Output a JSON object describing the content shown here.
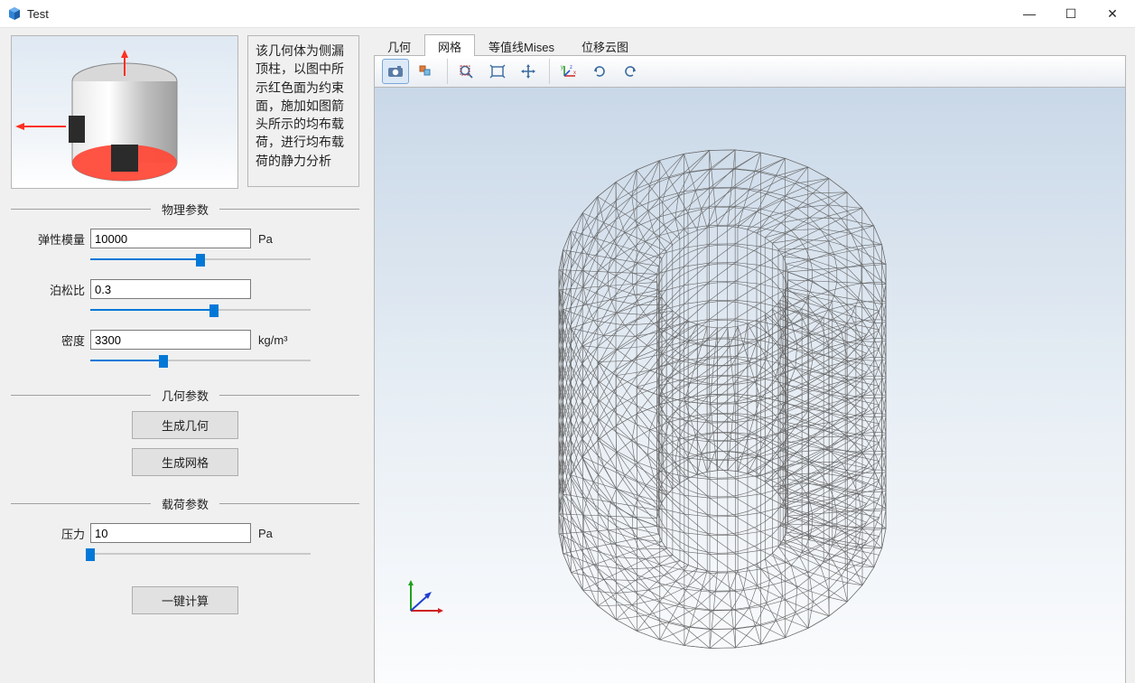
{
  "window": {
    "title": "Test",
    "btn_min": "—",
    "btn_max": "☐",
    "btn_close": "✕"
  },
  "description": "该几何体为侧漏顶柱，以图中所示红色面为约束面，施加如图箭头所示的均布载荷，进行均布载荷的静力分析",
  "sections": {
    "physics_title": "物理参数",
    "geometry_title": "几何参数",
    "load_title": "载荷参数"
  },
  "params": {
    "elastic_modulus": {
      "label": "弹性模量",
      "value": "10000",
      "unit": "Pa",
      "slider_pct": 50
    },
    "poisson": {
      "label": "泊松比",
      "value": "0.3",
      "unit": "",
      "slider_pct": 56
    },
    "density": {
      "label": "密度",
      "value": "3300",
      "unit": "kg/m³",
      "slider_pct": 33
    },
    "pressure": {
      "label": "压力",
      "value": "10",
      "unit": "Pa",
      "slider_pct": 0
    }
  },
  "buttons": {
    "gen_geometry": "生成几何",
    "gen_mesh": "生成网格",
    "compute": "一键计算"
  },
  "tabs": {
    "geometry": "几何",
    "mesh": "网格",
    "mises": "等值线Mises",
    "disp": "位移云图",
    "active": "mesh"
  },
  "toolbar": {
    "camera": "camera-icon",
    "display": "display-mode-icon",
    "zoom_rect": "zoom-rect-icon",
    "zoom_extents": "zoom-extents-icon",
    "pan": "pan-icon",
    "axes": "axes-icon",
    "rotate_cw": "rotate-cw-icon",
    "rotate_ccw": "rotate-ccw-icon"
  }
}
